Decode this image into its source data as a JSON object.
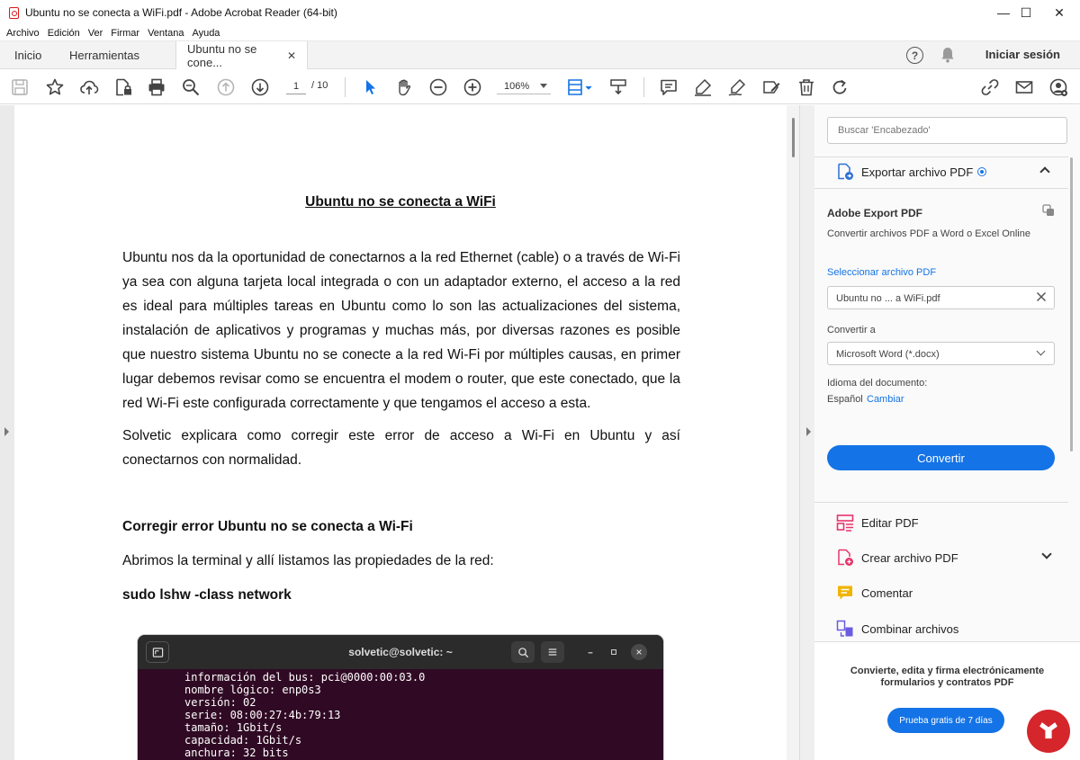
{
  "window": {
    "title": "Ubuntu no se conecta a WiFi.pdf - Adobe Acrobat Reader (64-bit)",
    "minimize_glyph": "—",
    "maximize_glyph": "☐",
    "close_glyph": "✕"
  },
  "menu": {
    "items": [
      "Archivo",
      "Edición",
      "Ver",
      "Firmar",
      "Ventana",
      "Ayuda"
    ]
  },
  "tabs": {
    "home": "Inicio",
    "tools": "Herramientas",
    "document": "Ubuntu no se cone...",
    "close_glyph": "✕",
    "help_glyph": "?",
    "signin": "Iniciar sesión"
  },
  "toolbar": {
    "page_current": "1",
    "page_total": "/ 10",
    "zoom": "106%"
  },
  "document": {
    "title": "Ubuntu no se conecta a WiFi",
    "paragraph1": "Ubuntu nos da la oportunidad de conectarnos a la red Ethernet (cable) o a través de Wi-Fi ya sea con alguna tarjeta local integrada o con un adaptador externo, el acceso a la red es ideal para múltiples tareas en Ubuntu como lo son las actualizaciones del sistema, instalación de aplicativos y programas y muchas más, por diversas razones es posible que nuestro sistema Ubuntu no se conecte a la red Wi-Fi por múltiples causas, en primer lugar debemos revisar como se encuentra el modem o router, que este conectado, que la red Wi-Fi este configurada correctamente y que tengamos el acceso a esta.",
    "paragraph2": "Solvetic explicara como corregir este error de acceso a Wi-Fi en Ubuntu y así conectarnos con normalidad.",
    "heading": "Corregir error Ubuntu no se conecta a Wi-Fi",
    "paragraph3": "Abrimos la terminal y allí listamos las propiedades de la red:",
    "command": "sudo lshw -class network",
    "terminal": {
      "title": "solvetic@solvetic: ~",
      "lines": [
        "información del bus: pci@0000:00:03.0",
        "nombre lógico: enp0s3",
        "versión: 02",
        "serie: 08:00:27:4b:79:13",
        "tamaño: 1Gbit/s",
        "capacidad: 1Gbit/s",
        "anchura: 32 bits"
      ]
    }
  },
  "panel": {
    "search_placeholder": "Buscar 'Encabezado'",
    "export_title": "Exportar archivo PDF",
    "export_heading": "Adobe Export PDF",
    "export_desc": "Convertir archivos PDF a Word o Excel Online",
    "select_label": "Seleccionar archivo PDF",
    "selected_file": "Ubuntu no ... a WiFi.pdf",
    "convert_to_label": "Convertir a",
    "convert_format": "Microsoft Word (*.docx)",
    "language_label": "Idioma del documento:",
    "language_value": "Español",
    "language_change": "Cambiar",
    "convert_button": "Convertir",
    "tools": [
      {
        "label": "Editar PDF",
        "color": "#e7346b"
      },
      {
        "label": "Crear archivo PDF",
        "color": "#e7346b"
      },
      {
        "label": "Comentar",
        "color": "#f0b400"
      },
      {
        "label": "Combinar archivos",
        "color": "#6a5be0"
      }
    ],
    "promo_text": "Convierte, edita y firma electrónicamente formularios y contratos PDF",
    "trial_button": "Prueba gratis de 7 días"
  },
  "colors": {
    "accent": "#1473e6",
    "terminal_bg": "#300a24",
    "acrobat_red": "#d71a1a"
  }
}
